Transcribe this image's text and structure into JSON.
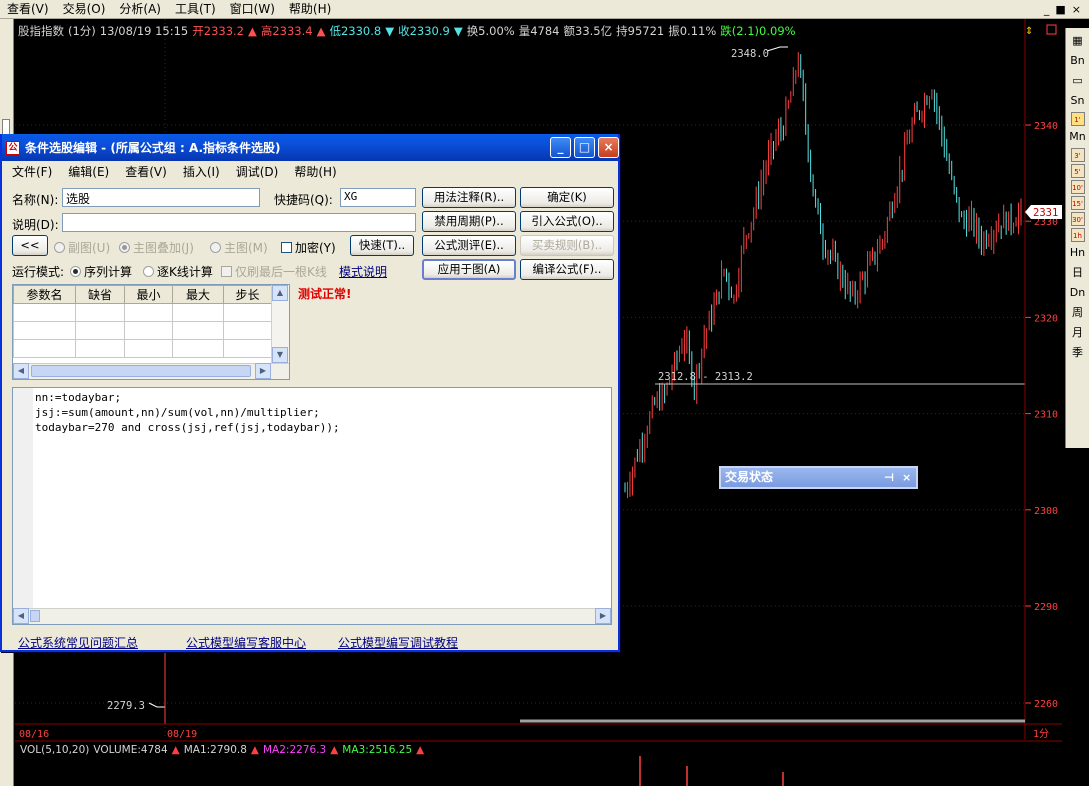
{
  "menubar": {
    "items": [
      "查看(V)",
      "交易(O)",
      "分析(A)",
      "工具(T)",
      "窗口(W)",
      "帮助(H)"
    ],
    "mdi_controls": [
      "_",
      "■",
      "×"
    ]
  },
  "infobar": {
    "name": "股指指数",
    "period": "(1分)",
    "datetime": "13/08/19 15:15",
    "open": "开2333.2",
    "high": "高2333.4",
    "low": "低2330.8",
    "close": "收2330.9",
    "turnover": "换5.00%",
    "volume": "量4784",
    "amount": "额33.5亿",
    "hold": "持95721",
    "amplitude": "振0.11%",
    "change": "跌(2.1)0.09%"
  },
  "chart": {
    "price_labels": [
      "2340",
      "2330",
      "2320",
      "2310",
      "2300",
      "2290",
      "2260"
    ],
    "current_price_badge": "2331",
    "high_annotation": "2348.0",
    "low_annotation": "2279.3",
    "range_annotation": "2312.8 - 2313.2",
    "date_labels": [
      "08/16",
      "08/19"
    ],
    "period_tab": "1分",
    "colors": {
      "up": "#ff4040",
      "down": "#56e3e3",
      "grid": "#8b0000",
      "axis": "#ff4040"
    }
  },
  "chart_data": {
    "type": "candlestick",
    "price_axis": [
      2260,
      2350
    ],
    "ticks": [
      2260,
      2290,
      2300,
      2310,
      2320,
      2330,
      2340
    ],
    "high": 2348.0,
    "low": 2279.3,
    "last": 2331,
    "range": [
      2312.8,
      2313.2
    ]
  },
  "volbar": {
    "name": "VOL(5,10,20)",
    "volume": "VOLUME:4784",
    "ma1": "MA1:2790.8",
    "ma2": "MA2:2276.3",
    "ma3": "MA3:2516.25"
  },
  "rtool": [
    "Bn",
    "Sn",
    "Mn",
    "3'",
    "5'",
    "10'",
    "15'",
    "30'",
    "1h",
    "Hn",
    "日",
    "Dn",
    "周",
    "月",
    "季"
  ],
  "dialog": {
    "title": "条件选股编辑 - (所属公式组 : A.指标条件选股)",
    "menu": [
      "文件(F)",
      "编辑(E)",
      "查看(V)",
      "插入(I)",
      "调试(D)",
      "帮助(H)"
    ],
    "name_label": "名称(N):",
    "name_value": "选股",
    "shortcut_label": "快捷码(Q):",
    "shortcut_value": "XG",
    "desc_label": "说明(D):",
    "desc_value": "",
    "collapse_btn": "<<",
    "radio_subgraph": "副图(U)",
    "radio_overlay": "主图叠加(J)",
    "radio_main": "主图(M)",
    "encrypt": "加密(Y)",
    "shortcut_btn": "快速(T)..",
    "run_mode_label": "运行模式:",
    "mode_seq": "序列计算",
    "mode_kline": "逐K线计算",
    "mode_last": "仅刷最后一根K线",
    "mode_link": "模式说明",
    "buttons": {
      "usage": "用法注释(R)..",
      "ok": "确定(K)",
      "disable_period": "禁用周期(P)..",
      "import": "引入公式(O)..",
      "test": "公式测评(E)..",
      "trade_rule": "买卖规则(B)..",
      "apply": "应用于图(A)",
      "compile": "编译公式(F).."
    },
    "param_headers": [
      "参数名",
      "缺省",
      "最小",
      "最大",
      "步长"
    ],
    "test_status": "测试正常!",
    "code": "nn:=todaybar;\njsj:=sum(amount,nn)/sum(vol,nn)/multiplier;\ntodaybar=270 and cross(jsj,ref(jsj,todaybar));",
    "links": [
      "公式系统常见问题汇总",
      "公式模型编写客服中心",
      "公式模型编写调试教程"
    ]
  },
  "trade_window": {
    "title": "交易状态",
    "pin": "⊣",
    "close": "×"
  }
}
